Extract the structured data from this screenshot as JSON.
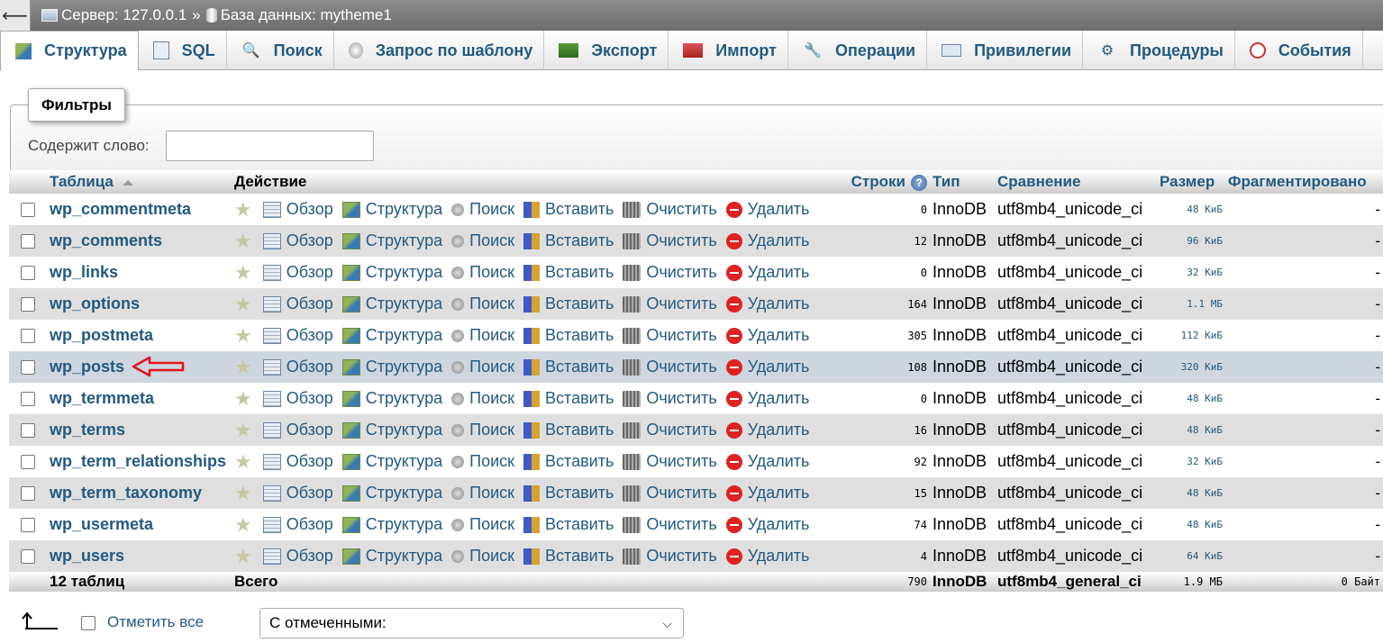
{
  "breadcrumb": {
    "server": "Сервер: 127.0.0.1",
    "separator": "»",
    "database": "База данных: mytheme1"
  },
  "tabs": [
    {
      "label": "Структура",
      "icon": "structure-icon"
    },
    {
      "label": "SQL",
      "icon": "sql-icon"
    },
    {
      "label": "Поиск",
      "icon": "search-icon"
    },
    {
      "label": "Запрос по шаблону",
      "icon": "query-icon"
    },
    {
      "label": "Экспорт",
      "icon": "export-icon"
    },
    {
      "label": "Импорт",
      "icon": "import-icon"
    },
    {
      "label": "Операции",
      "icon": "wrench-icon"
    },
    {
      "label": "Привилегии",
      "icon": "privileges-icon"
    },
    {
      "label": "Процедуры",
      "icon": "routines-icon"
    },
    {
      "label": "События",
      "icon": "clock-icon"
    }
  ],
  "filter": {
    "legend": "Фильтры",
    "label": "Содержит слово:",
    "value": ""
  },
  "columns": {
    "table": "Таблица",
    "action": "Действие",
    "rows": "Строки",
    "type": "Тип",
    "collation": "Сравнение",
    "size": "Размер",
    "overhead": "Фрагментировано"
  },
  "actions": {
    "browse": "Обзор",
    "structure": "Структура",
    "search": "Поиск",
    "insert": "Вставить",
    "empty": "Очистить",
    "drop": "Удалить"
  },
  "tables": [
    {
      "name": "wp_commentmeta",
      "rows": "0",
      "type": "InnoDB",
      "collation": "utf8mb4_unicode_ci",
      "size": "48 КиБ",
      "overhead": "-"
    },
    {
      "name": "wp_comments",
      "rows": "12",
      "type": "InnoDB",
      "collation": "utf8mb4_unicode_ci",
      "size": "96 КиБ",
      "overhead": "-"
    },
    {
      "name": "wp_links",
      "rows": "0",
      "type": "InnoDB",
      "collation": "utf8mb4_unicode_ci",
      "size": "32 КиБ",
      "overhead": "-"
    },
    {
      "name": "wp_options",
      "rows": "164",
      "type": "InnoDB",
      "collation": "utf8mb4_unicode_ci",
      "size": "1.1 МБ",
      "overhead": "-"
    },
    {
      "name": "wp_postmeta",
      "rows": "305",
      "type": "InnoDB",
      "collation": "utf8mb4_unicode_ci",
      "size": "112 КиБ",
      "overhead": "-"
    },
    {
      "name": "wp_posts",
      "rows": "108",
      "type": "InnoDB",
      "collation": "utf8mb4_unicode_ci",
      "size": "320 КиБ",
      "overhead": "-"
    },
    {
      "name": "wp_termmeta",
      "rows": "0",
      "type": "InnoDB",
      "collation": "utf8mb4_unicode_ci",
      "size": "48 КиБ",
      "overhead": "-"
    },
    {
      "name": "wp_terms",
      "rows": "16",
      "type": "InnoDB",
      "collation": "utf8mb4_unicode_ci",
      "size": "48 КиБ",
      "overhead": "-"
    },
    {
      "name": "wp_term_relationships",
      "rows": "92",
      "type": "InnoDB",
      "collation": "utf8mb4_unicode_ci",
      "size": "32 КиБ",
      "overhead": "-"
    },
    {
      "name": "wp_term_taxonomy",
      "rows": "15",
      "type": "InnoDB",
      "collation": "utf8mb4_unicode_ci",
      "size": "48 КиБ",
      "overhead": "-"
    },
    {
      "name": "wp_usermeta",
      "rows": "74",
      "type": "InnoDB",
      "collation": "utf8mb4_unicode_ci",
      "size": "48 КиБ",
      "overhead": "-"
    },
    {
      "name": "wp_users",
      "rows": "4",
      "type": "InnoDB",
      "collation": "utf8mb4_unicode_ci",
      "size": "64 КиБ",
      "overhead": "-"
    }
  ],
  "highlighted_table": "wp_posts",
  "total": {
    "label": "12 таблиц",
    "action": "Всего",
    "rows": "790",
    "type": "InnoDB",
    "collation": "utf8mb4_general_ci",
    "size": "1.9 МБ",
    "overhead": "0 Байт"
  },
  "footer": {
    "check_all": "Отметить все",
    "with_selected": "С отмеченными:"
  },
  "colors": {
    "link": "#235a81",
    "annotation_arrow": "#e0141e"
  }
}
